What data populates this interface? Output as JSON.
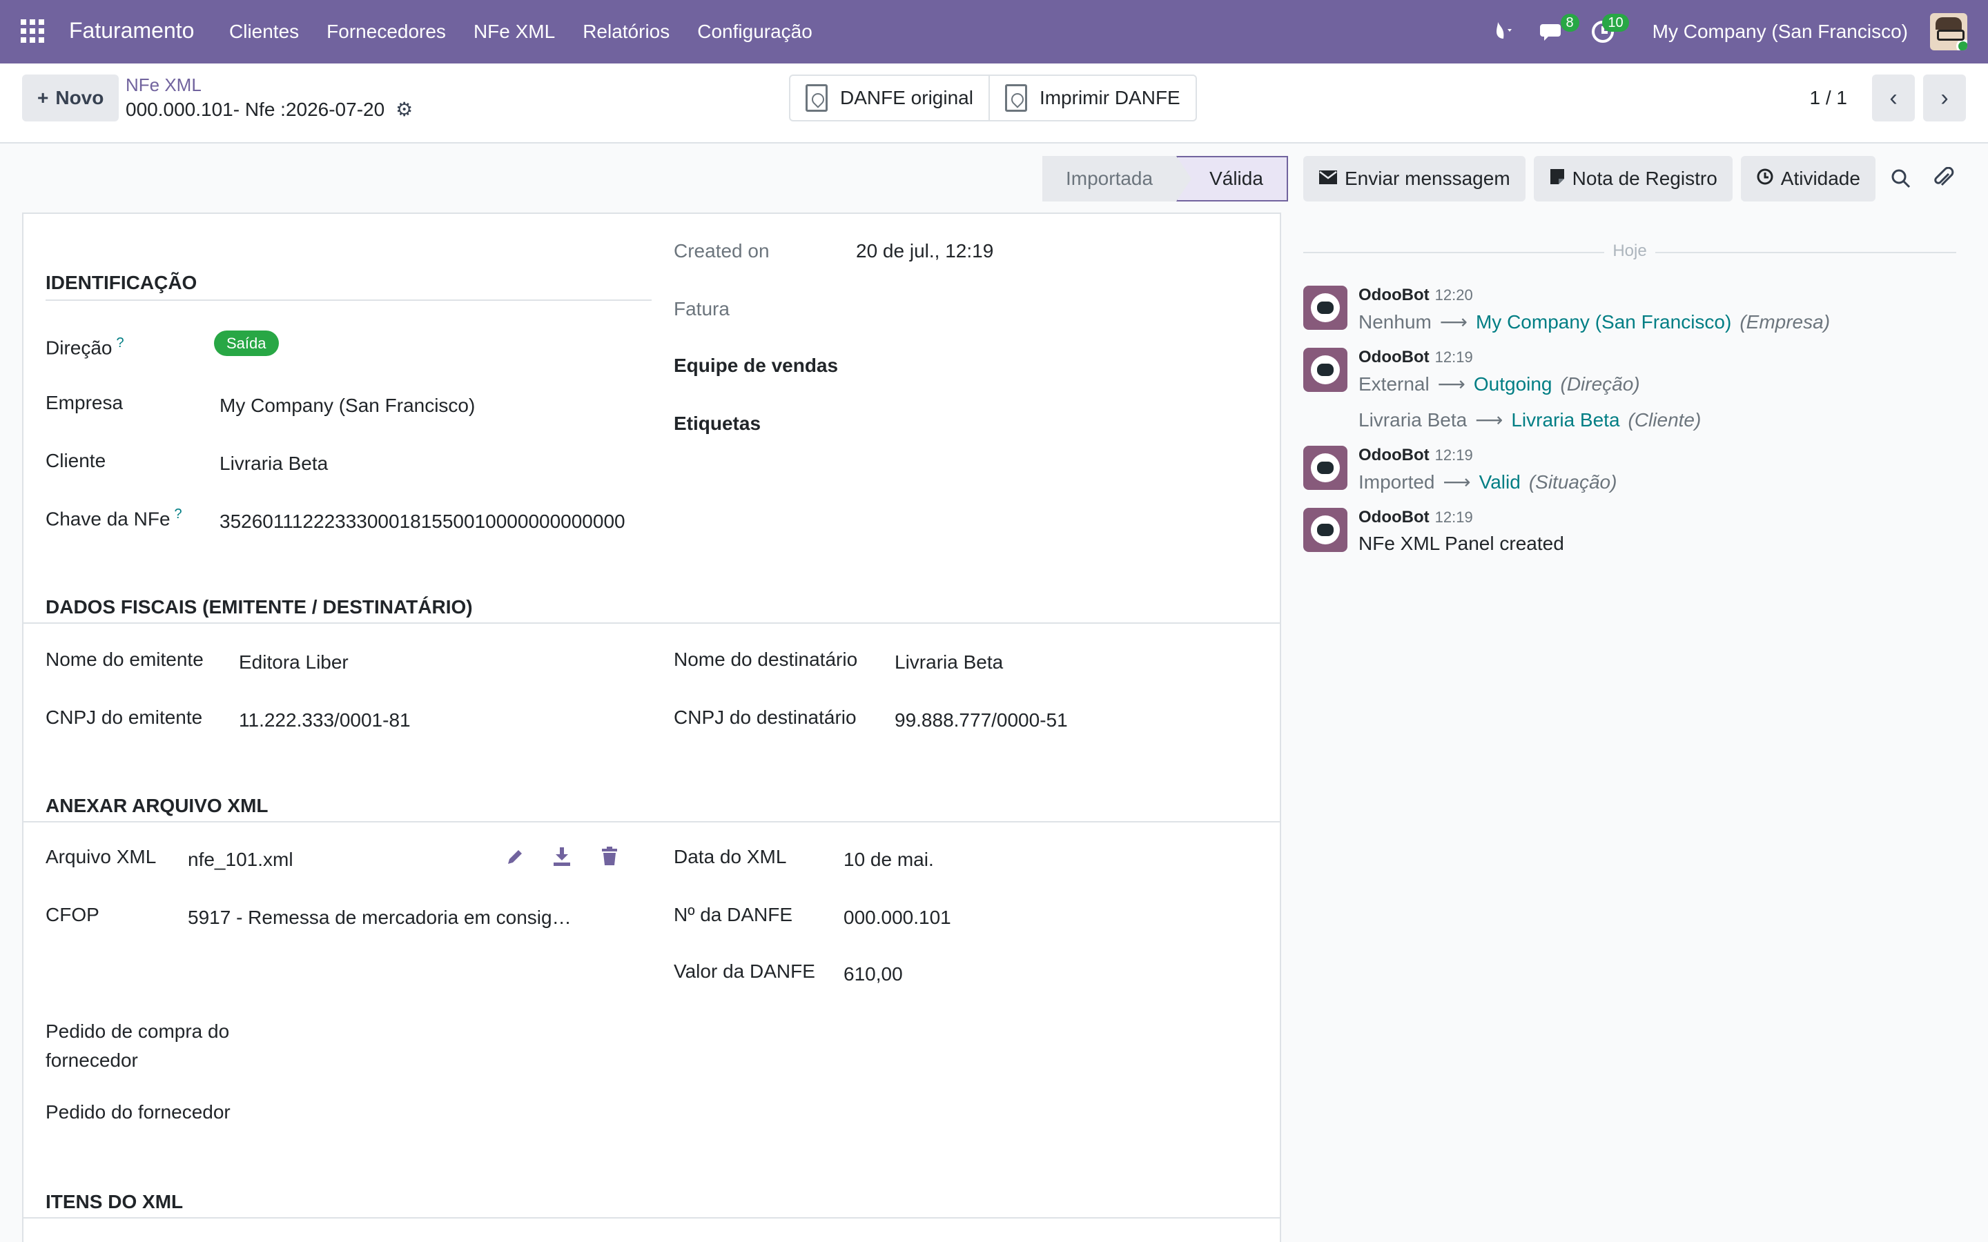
{
  "navbar": {
    "app_name": "Faturamento",
    "menu": [
      "Clientes",
      "Fornecedores",
      "NFe XML",
      "Relatórios",
      "Configuração"
    ],
    "messages_count": "8",
    "activities_count": "10",
    "company": "My Company (San Francisco)",
    "icons": [
      "apps-icon",
      "debug-icon",
      "messages-icon",
      "activities-icon"
    ]
  },
  "control": {
    "new_label": "Novo",
    "breadcrumb_parent": "NFe XML",
    "breadcrumb_current": "000.000.101- Nfe :2026-07-20",
    "print_buttons": [
      "DANFE original",
      "Imprimir DANFE"
    ],
    "pager": "1 / 1"
  },
  "status": {
    "steps": [
      "Importada",
      "Válida"
    ],
    "active": "Válida"
  },
  "form": {
    "identificacao": {
      "title": "IDENTIFICAÇÃO",
      "direcao_label": "Direção",
      "direcao_value": "Saída",
      "empresa_label": "Empresa",
      "empresa_value": "My Company (San Francisco)",
      "cliente_label": "Cliente",
      "cliente_value": "Livraria Beta",
      "chave_label": "Chave da NFe",
      "chave_value": "35260111222333000181550010000000000000"
    },
    "right_top": {
      "created_label": "Created on",
      "created_value": "20 de jul., 12:19",
      "fatura_label": "Fatura",
      "equipe_label": "Equipe de vendas",
      "etiquetas_label": "Etiquetas"
    },
    "fiscais": {
      "title": "DADOS FISCAIS (EMITENTE / DESTINATÁRIO)",
      "nome_emitente_label": "Nome do emitente",
      "nome_emitente_value": "Editora Liber",
      "cnpj_emitente_label": "CNPJ do emitente",
      "cnpj_emitente_value": "11.222.333/0001-81",
      "nome_dest_label": "Nome do destinatário",
      "nome_dest_value": "Livraria Beta",
      "cnpj_dest_label": "CNPJ do destinatário",
      "cnpj_dest_value": "99.888.777/0000-51"
    },
    "anexar": {
      "title": "ANEXAR ARQUIVO XML",
      "arquivo_label": "Arquivo XML",
      "arquivo_value": "nfe_101.xml",
      "cfop_label": "CFOP",
      "cfop_value": "5917 - Remessa de mercadoria em consig…",
      "pedido_compra_label_1": "Pedido de compra do",
      "pedido_compra_label_2": "fornecedor",
      "pedido_fornecedor_label": "Pedido do fornecedor",
      "data_xml_label": "Data do XML",
      "data_xml_value": "10 de mai.",
      "num_danfe_label": "Nº da DANFE",
      "num_danfe_value": "000.000.101",
      "valor_danfe_label": "Valor da DANFE",
      "valor_danfe_value": "610,00"
    },
    "itens": {
      "title": "ITENS DO XML"
    }
  },
  "chatter": {
    "buttons": [
      "Enviar menssagem",
      "Nota de Registro",
      "Atividade"
    ],
    "today": "Hoje",
    "messages": [
      {
        "author": "OdooBot",
        "time": "12:20",
        "lines": [
          {
            "old": "Nenhum",
            "new": "My Company (San Francisco)",
            "field": "(Empresa)"
          }
        ]
      },
      {
        "author": "OdooBot",
        "time": "12:19",
        "lines": [
          {
            "old": "External",
            "new": "Outgoing",
            "field": "(Direção)"
          },
          {
            "old": "Livraria Beta",
            "new": "Livraria Beta",
            "field": "(Cliente)"
          }
        ]
      },
      {
        "author": "OdooBot",
        "time": "12:19",
        "lines": [
          {
            "old": "Imported",
            "new": "Valid",
            "field": "(Situação)"
          }
        ]
      },
      {
        "author": "OdooBot",
        "time": "12:19",
        "text": "NFe XML Panel created"
      }
    ]
  },
  "colors": {
    "brand": "#71639e",
    "link": "#017e84",
    "success": "#28a745"
  }
}
